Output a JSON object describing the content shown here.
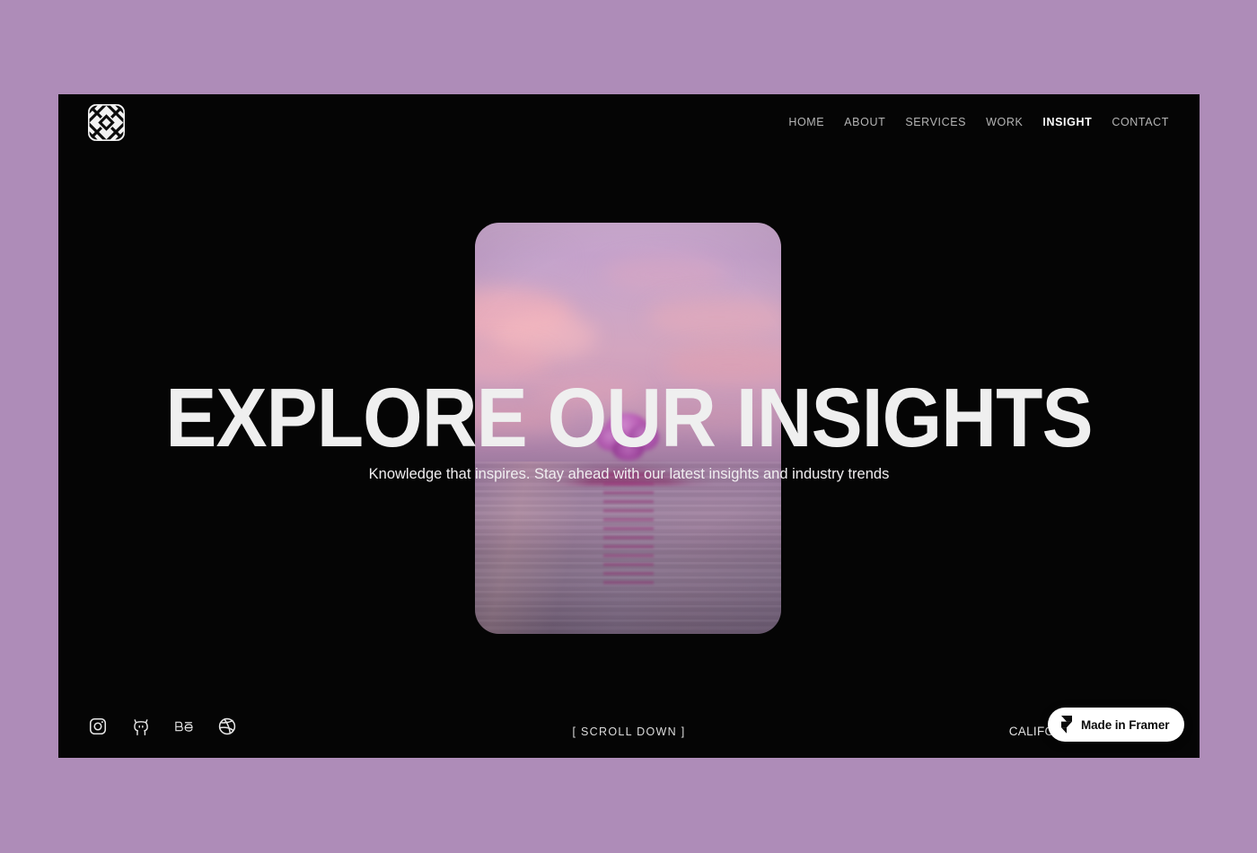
{
  "theme": {
    "page_background": "#ae8cb8",
    "viewport_background": "#050505",
    "text_primary": "#ffffff",
    "text_muted": "#b5b5b5",
    "badge_background": "#ffffff",
    "badge_text": "#0b0b0b"
  },
  "header": {
    "logo_name": "woven-diamond-logo",
    "nav": [
      {
        "label": "HOME",
        "active": false
      },
      {
        "label": "ABOUT",
        "active": false
      },
      {
        "label": "SERVICES",
        "active": false
      },
      {
        "label": "WORK",
        "active": false
      },
      {
        "label": "INSIGHT",
        "active": true
      },
      {
        "label": "CONTACT",
        "active": false
      }
    ]
  },
  "hero": {
    "title": "EXPLORE OUR INSIGHTS",
    "subtitle": "Knowledge that inspires. Stay ahead with our latest insights and industry trends",
    "image_alt": "pink sunset sky with blossom tree on small island reflected in still water"
  },
  "footer": {
    "socials": [
      {
        "name": "instagram-icon",
        "label": "Instagram"
      },
      {
        "name": "github-icon",
        "label": "GitHub"
      },
      {
        "name": "behance-icon",
        "label": "Behance"
      },
      {
        "name": "dribbble-icon",
        "label": "Dribbble"
      }
    ],
    "scroll_label": "[   SCROLL DOWN   ]",
    "location": "CALIFORNIA , USA 6:28 pm"
  },
  "framer_badge": {
    "label": "Made in Framer",
    "icon_name": "framer-logo-icon"
  }
}
